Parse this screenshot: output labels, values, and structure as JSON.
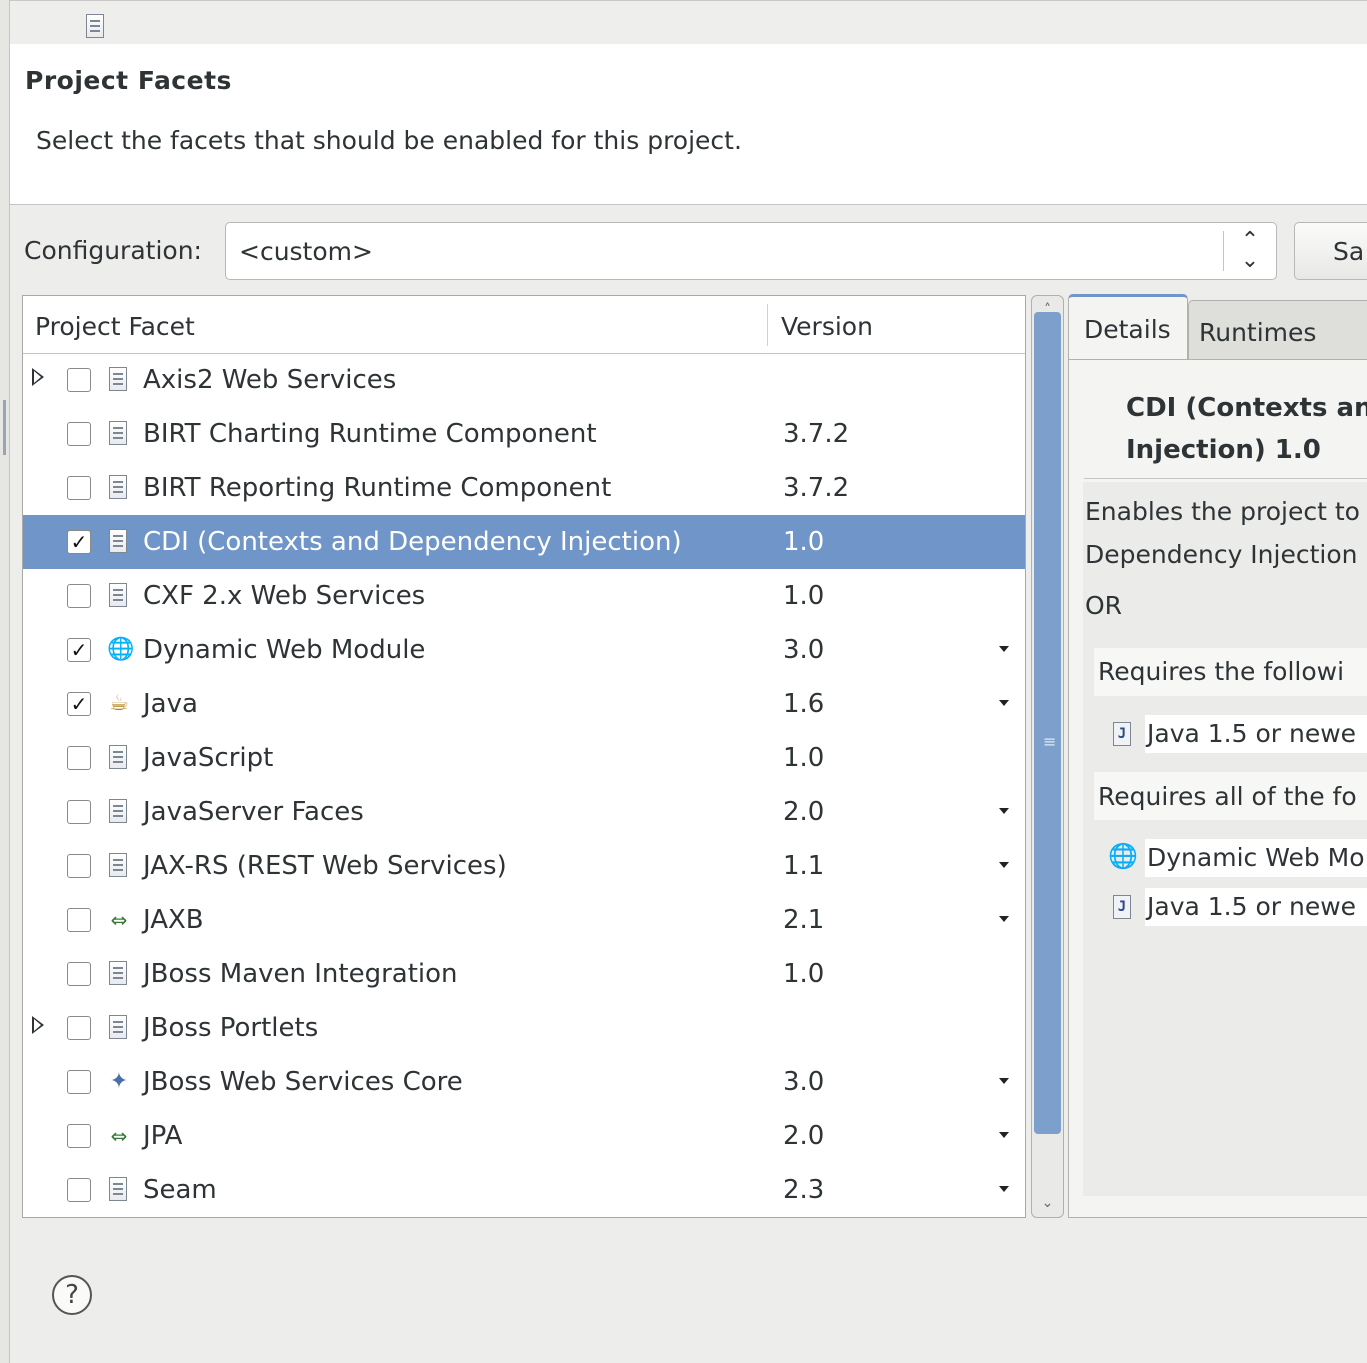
{
  "page": {
    "title": "Project Facets",
    "subtitle": "Select the facets that should be enabled for this project."
  },
  "configuration": {
    "label": "Configuration:",
    "value": "<custom>",
    "save_button": "Sa"
  },
  "table": {
    "col_facet": "Project Facet",
    "col_version": "Version",
    "rows": [
      {
        "name": "Axis2 Web Services",
        "version": "",
        "checked": false,
        "expandable": true,
        "icon": "document-icon",
        "dropdown": false
      },
      {
        "name": "BIRT Charting Runtime Component",
        "version": "3.7.2",
        "checked": false,
        "expandable": false,
        "icon": "document-icon",
        "dropdown": false
      },
      {
        "name": "BIRT Reporting Runtime Component",
        "version": "3.7.2",
        "checked": false,
        "expandable": false,
        "icon": "document-icon",
        "dropdown": false
      },
      {
        "name": "CDI (Contexts and Dependency Injection)",
        "version": "1.0",
        "checked": true,
        "expandable": false,
        "icon": "document-icon",
        "dropdown": false,
        "selected": true
      },
      {
        "name": "CXF 2.x Web Services",
        "version": "1.0",
        "checked": false,
        "expandable": false,
        "icon": "document-icon",
        "dropdown": false
      },
      {
        "name": "Dynamic Web Module",
        "version": "3.0",
        "checked": true,
        "expandable": false,
        "icon": "web-module-icon",
        "dropdown": true
      },
      {
        "name": "Java",
        "version": "1.6",
        "checked": true,
        "expandable": false,
        "icon": "java-icon",
        "dropdown": true
      },
      {
        "name": "JavaScript",
        "version": "1.0",
        "checked": false,
        "expandable": false,
        "icon": "document-icon",
        "dropdown": false
      },
      {
        "name": "JavaServer Faces",
        "version": "2.0",
        "checked": false,
        "expandable": false,
        "icon": "document-icon",
        "dropdown": true
      },
      {
        "name": "JAX-RS (REST Web Services)",
        "version": "1.1",
        "checked": false,
        "expandable": false,
        "icon": "document-icon",
        "dropdown": true
      },
      {
        "name": "JAXB",
        "version": "2.1",
        "checked": false,
        "expandable": false,
        "icon": "jaxb-arrows-icon",
        "dropdown": true
      },
      {
        "name": "JBoss Maven Integration",
        "version": "1.0",
        "checked": false,
        "expandable": false,
        "icon": "document-icon",
        "dropdown": false
      },
      {
        "name": "JBoss Portlets",
        "version": "",
        "checked": false,
        "expandable": true,
        "icon": "document-icon",
        "dropdown": false
      },
      {
        "name": "JBoss Web Services Core",
        "version": "3.0",
        "checked": false,
        "expandable": false,
        "icon": "jboss-ws-icon",
        "dropdown": true
      },
      {
        "name": "JPA",
        "version": "2.0",
        "checked": false,
        "expandable": false,
        "icon": "jpa-arrows-icon",
        "dropdown": true
      },
      {
        "name": "Seam",
        "version": "2.3",
        "checked": false,
        "expandable": false,
        "icon": "document-icon",
        "dropdown": true
      }
    ]
  },
  "tabs": {
    "details": "Details",
    "runtimes": "Runtimes"
  },
  "details": {
    "title_line1": "CDI (Contexts an",
    "title_line2": "Injection) 1.0",
    "desc_line1": "Enables the project to",
    "desc_line2": "Dependency Injection",
    "or": "OR",
    "requires_following": "Requires the followi",
    "req1": "Java 1.5 or newe",
    "requires_all": "Requires all of the fo",
    "req2": "Dynamic Web Mo",
    "req3": "Java 1.5 or newe"
  },
  "colors": {
    "selection": "#6f95c9",
    "background": "#ededeb"
  }
}
